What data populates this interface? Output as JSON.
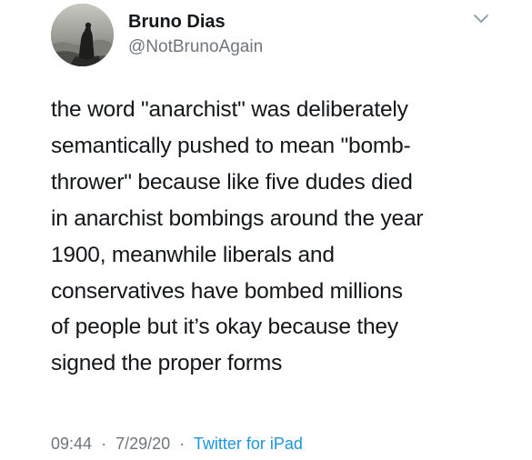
{
  "author": {
    "display_name": "Bruno Dias",
    "handle": "@NotBrunoAgain"
  },
  "tweet": {
    "lines": [
      "the word \"anarchist\" was deliberately",
      "semantically pushed to mean \"bomb-",
      "thrower\" because like five dudes died",
      "in anarchist bombings around the year",
      "1900, meanwhile liberals and",
      "conservatives have bombed millions",
      "of people but it’s okay because they",
      "signed the proper forms"
    ]
  },
  "meta": {
    "time": "09:44",
    "separator": "·",
    "date": "7/29/20",
    "source": "Twitter for iPad"
  },
  "colors": {
    "text": "#14171a",
    "secondary": "#6e767d",
    "link": "#1b95e0"
  },
  "icons": {
    "menu": "chevron-down-icon"
  }
}
